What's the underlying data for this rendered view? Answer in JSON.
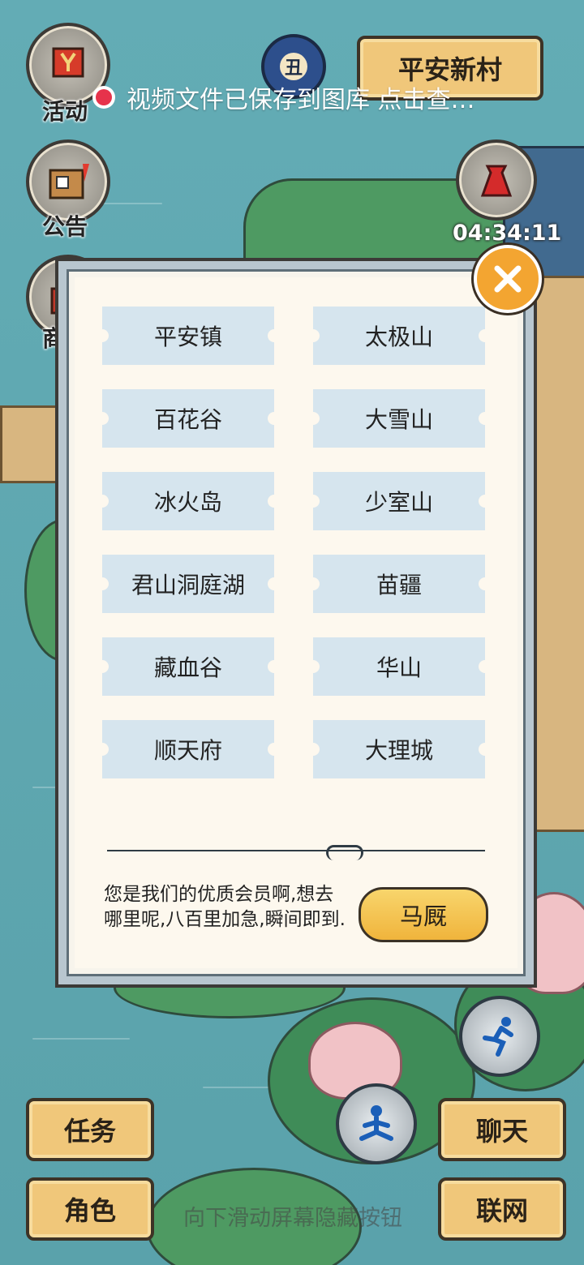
{
  "top": {
    "left_buttons": [
      {
        "label": "活动",
        "icon": "flag-icon"
      },
      {
        "label": "公告",
        "icon": "notice-board-icon"
      },
      {
        "label": "商",
        "icon": "shop-icon"
      }
    ],
    "time_icon_text": "丑",
    "location": "平安新村",
    "notice": "视频文件已保存到图库  点击查…",
    "timer": "04:34:11"
  },
  "dialog": {
    "destinations": [
      "平安镇",
      "太极山",
      "百花谷",
      "大雪山",
      "冰火岛",
      "少室山",
      "君山洞庭湖",
      "苗疆",
      "藏血谷",
      "华山",
      "顺天府",
      "大理城"
    ],
    "message": "您是我们的优质会员啊,想去哪里呢,八百里加急,瞬间即到.",
    "confirm_label": "马厩"
  },
  "bottom": {
    "task_label": "任务",
    "role_label": "角色",
    "chat_label": "聊天",
    "network_label": "联网",
    "hint": "向下滑动屏幕隐藏按钮"
  },
  "colors": {
    "water": "#5fa9b2",
    "plaque": "#f0c77a",
    "close": "#f3a531",
    "tile": "#d6e5ee"
  }
}
